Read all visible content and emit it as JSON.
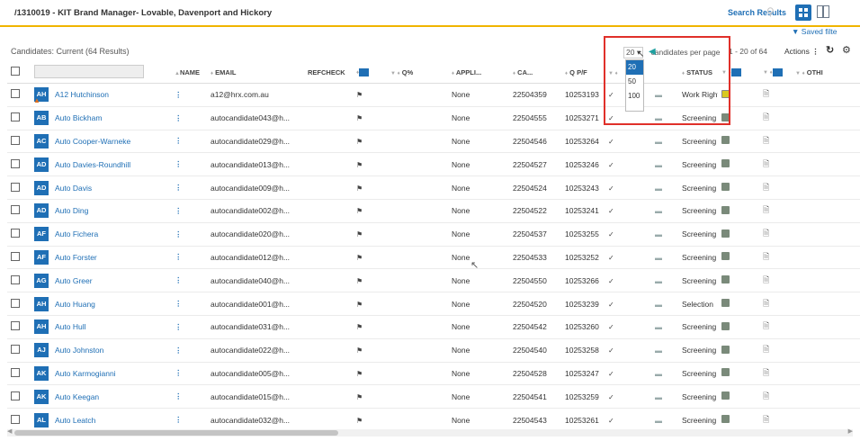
{
  "header": {
    "job_title": "/1310019 - KIT Brand Manager- Lovable, Davenport and Hickory",
    "search_results": "Search Results",
    "saved_filters": "Saved filte"
  },
  "toolbar": {
    "candidates_title": "Candidates: Current (64 Results)",
    "per_page_value": "20",
    "per_page_label": "candidates per page",
    "per_page_options": [
      "20",
      "50",
      "100"
    ],
    "pager_text": "1 - 20 of 64",
    "actions_label": "Actions"
  },
  "columns": {
    "name": "NAME",
    "email": "EMAIL",
    "refcheck": "REFCHECK",
    "q_pct": "Q%",
    "appli": "APPLI...",
    "ca": "CA...",
    "qpf": "Q P/F",
    "status": "STATUS",
    "other": "OTHI"
  },
  "rows": [
    {
      "initials": "AH",
      "name": "A12 Hutchinson",
      "email": "a12@hrx.com.au",
      "q": "None",
      "appli": "22504359",
      "ca": "10253193",
      "status": "Work Rights ...",
      "doc": "yellow",
      "warn": true
    },
    {
      "initials": "AB",
      "name": "Auto Bickham",
      "email": "autocandidate043@h...",
      "q": "None",
      "appli": "22504555",
      "ca": "10253271",
      "status": "Screening",
      "doc": "grey"
    },
    {
      "initials": "AC",
      "name": "Auto Cooper-Warneke",
      "email": "autocandidate029@h...",
      "q": "None",
      "appli": "22504546",
      "ca": "10253264",
      "status": "Screening",
      "doc": "grey"
    },
    {
      "initials": "AD",
      "name": "Auto Davies-Roundhill",
      "email": "autocandidate013@h...",
      "q": "None",
      "appli": "22504527",
      "ca": "10253246",
      "status": "Screening",
      "doc": "grey"
    },
    {
      "initials": "AD",
      "name": "Auto Davis",
      "email": "autocandidate009@h...",
      "q": "None",
      "appli": "22504524",
      "ca": "10253243",
      "status": "Screening",
      "doc": "grey"
    },
    {
      "initials": "AD",
      "name": "Auto Ding",
      "email": "autocandidate002@h...",
      "q": "None",
      "appli": "22504522",
      "ca": "10253241",
      "status": "Screening",
      "doc": "grey"
    },
    {
      "initials": "AF",
      "name": "Auto Fichera",
      "email": "autocandidate020@h...",
      "q": "None",
      "appli": "22504537",
      "ca": "10253255",
      "status": "Screening",
      "doc": "grey"
    },
    {
      "initials": "AF",
      "name": "Auto Forster",
      "email": "autocandidate012@h...",
      "q": "None",
      "appli": "22504533",
      "ca": "10253252",
      "status": "Screening",
      "doc": "grey"
    },
    {
      "initials": "AG",
      "name": "Auto Greer",
      "email": "autocandidate040@h...",
      "q": "None",
      "appli": "22504550",
      "ca": "10253266",
      "status": "Screening",
      "doc": "grey"
    },
    {
      "initials": "AH",
      "name": "Auto Huang",
      "email": "autocandidate001@h...",
      "q": "None",
      "appli": "22504520",
      "ca": "10253239",
      "status": "Selection",
      "doc": "grey"
    },
    {
      "initials": "AH",
      "name": "Auto Hull",
      "email": "autocandidate031@h...",
      "q": "None",
      "appli": "22504542",
      "ca": "10253260",
      "status": "Screening",
      "doc": "grey"
    },
    {
      "initials": "AJ",
      "name": "Auto Johnston",
      "email": "autocandidate022@h...",
      "q": "None",
      "appli": "22504540",
      "ca": "10253258",
      "status": "Screening",
      "doc": "grey"
    },
    {
      "initials": "AK",
      "name": "Auto Karmogianni",
      "email": "autocandidate005@h...",
      "q": "None",
      "appli": "22504528",
      "ca": "10253247",
      "status": "Screening",
      "doc": "grey"
    },
    {
      "initials": "AK",
      "name": "Auto Keegan",
      "email": "autocandidate015@h...",
      "q": "None",
      "appli": "22504541",
      "ca": "10253259",
      "status": "Screening",
      "doc": "grey"
    },
    {
      "initials": "AL",
      "name": "Auto Leatch",
      "email": "autocandidate032@h...",
      "q": "None",
      "appli": "22504543",
      "ca": "10253261",
      "status": "Screening",
      "doc": "grey"
    }
  ],
  "colors": {
    "accent": "#1f6fb5",
    "header_border": "#f0b400",
    "highlight": "#e0302a"
  }
}
